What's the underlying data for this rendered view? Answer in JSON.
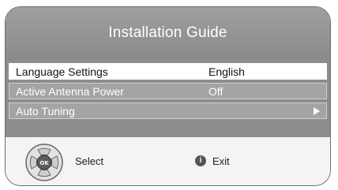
{
  "title": "Installation Guide",
  "menu": {
    "items": [
      {
        "label": "Language Settings",
        "value": "English",
        "selected": true
      },
      {
        "label": "Active Antenna Power",
        "value": "Off",
        "selected": false
      },
      {
        "label": "Auto Tuning",
        "value": "",
        "selected": false
      }
    ]
  },
  "footer": {
    "select_label": "Select",
    "ok_label": "OK",
    "exit_icon_glyph": "i",
    "exit_label": "Exit"
  },
  "colors": {
    "header": "#9a9a9a",
    "selected_row": "#ffffff",
    "unselected_row": "#a4a4a4"
  }
}
